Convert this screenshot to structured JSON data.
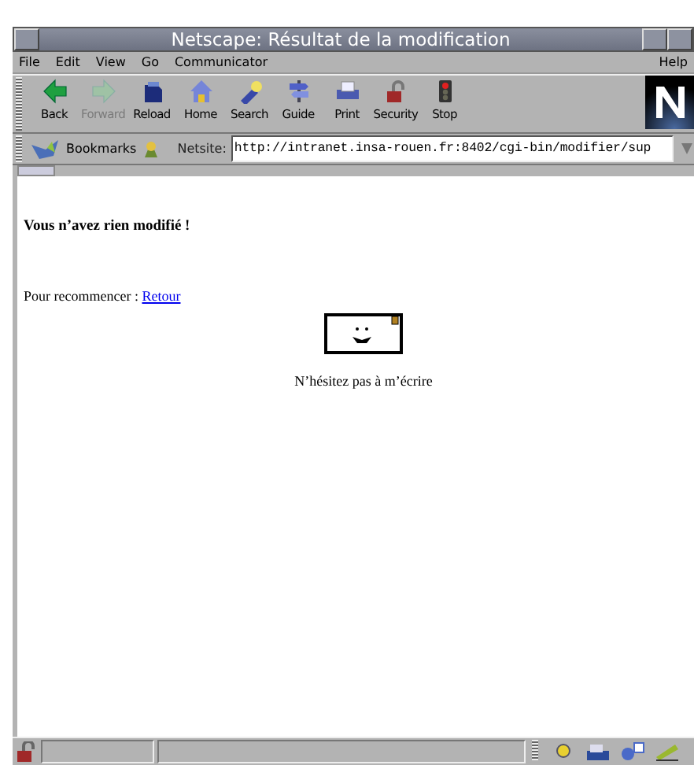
{
  "window": {
    "title": "Netscape: Résultat de la modification"
  },
  "menu": [
    {
      "label": "File"
    },
    {
      "label": "Edit"
    },
    {
      "label": "View"
    },
    {
      "label": "Go"
    },
    {
      "label": "Communicator"
    }
  ],
  "help_menu": {
    "label": "Help"
  },
  "toolbar": [
    {
      "label": "Back",
      "kind": "back",
      "disabled": false
    },
    {
      "label": "Forward",
      "kind": "forward",
      "disabled": true
    },
    {
      "label": "Reload",
      "kind": "reload",
      "disabled": false
    },
    {
      "label": "Home",
      "kind": "home",
      "disabled": false
    },
    {
      "label": "Search",
      "kind": "search",
      "disabled": false
    },
    {
      "label": "Guide",
      "kind": "guide",
      "disabled": false
    },
    {
      "label": "Print",
      "kind": "print",
      "disabled": false
    },
    {
      "label": "Security",
      "kind": "security",
      "disabled": false
    },
    {
      "label": "Stop",
      "kind": "stop",
      "disabled": false
    }
  ],
  "location_bar": {
    "bookmarks": "Bookmarks",
    "label": "Netsite:",
    "url": "http://intranet.insa-rouen.fr:8402/cgi-bin/modifier/sup"
  },
  "content": {
    "heading": "Vous n’avez rien modifié !",
    "prompt": "Pour recommencer : ",
    "link": "Retour",
    "caption": "N’hésitez pas à m’écrire"
  }
}
